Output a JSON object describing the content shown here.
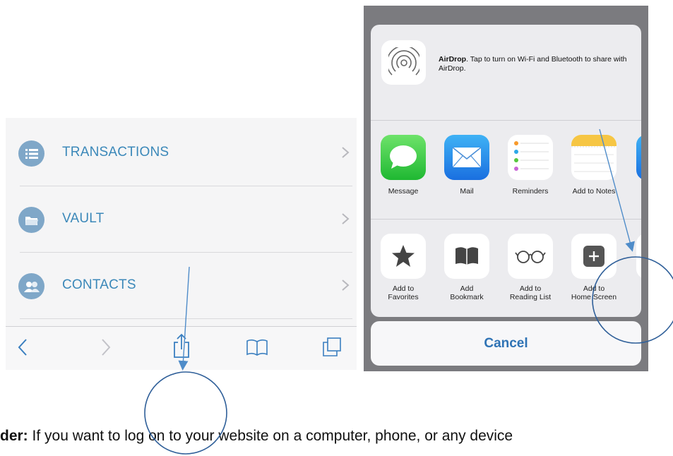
{
  "left_menu": {
    "items": [
      {
        "label": "TRANSACTIONS",
        "icon": "list-icon"
      },
      {
        "label": "VAULT",
        "icon": "folder-icon"
      },
      {
        "label": "CONTACTS",
        "icon": "contacts-icon"
      }
    ]
  },
  "browser_toolbar": {
    "buttons": [
      "back-icon",
      "forward-icon",
      "share-icon",
      "bookmarks-icon",
      "tabs-icon"
    ]
  },
  "share_sheet": {
    "airdrop": {
      "title": "AirDrop",
      "text": ". Tap to turn on Wi-Fi and Bluetooth to share with AirDrop."
    },
    "apps": [
      {
        "label": "Message",
        "icon": "message-icon"
      },
      {
        "label": "Mail",
        "icon": "mail-icon"
      },
      {
        "label": "Reminders",
        "icon": "reminders-icon"
      },
      {
        "label": "Add to Notes",
        "icon": "notes-icon"
      }
    ],
    "actions": [
      {
        "line1": "Add to",
        "line2": "Favorites",
        "icon": "star-icon"
      },
      {
        "line1": "Add",
        "line2": "Bookmark",
        "icon": "book-icon"
      },
      {
        "line1": "Add to",
        "line2": "Reading List",
        "icon": "glasses-icon"
      },
      {
        "line1": "Add to",
        "line2": "Home Screen",
        "icon": "plus-icon"
      }
    ],
    "cancel_label": "Cancel"
  },
  "caption": {
    "bold_part": "der:",
    "text": " If you want to log on to your website on a computer, phone, or any device"
  },
  "colors": {
    "menu_text": "#3b88b9",
    "menu_icon_bg": "#7fa7c8",
    "cancel_text": "#2f73b5",
    "annotation": "#3e6fa6"
  }
}
